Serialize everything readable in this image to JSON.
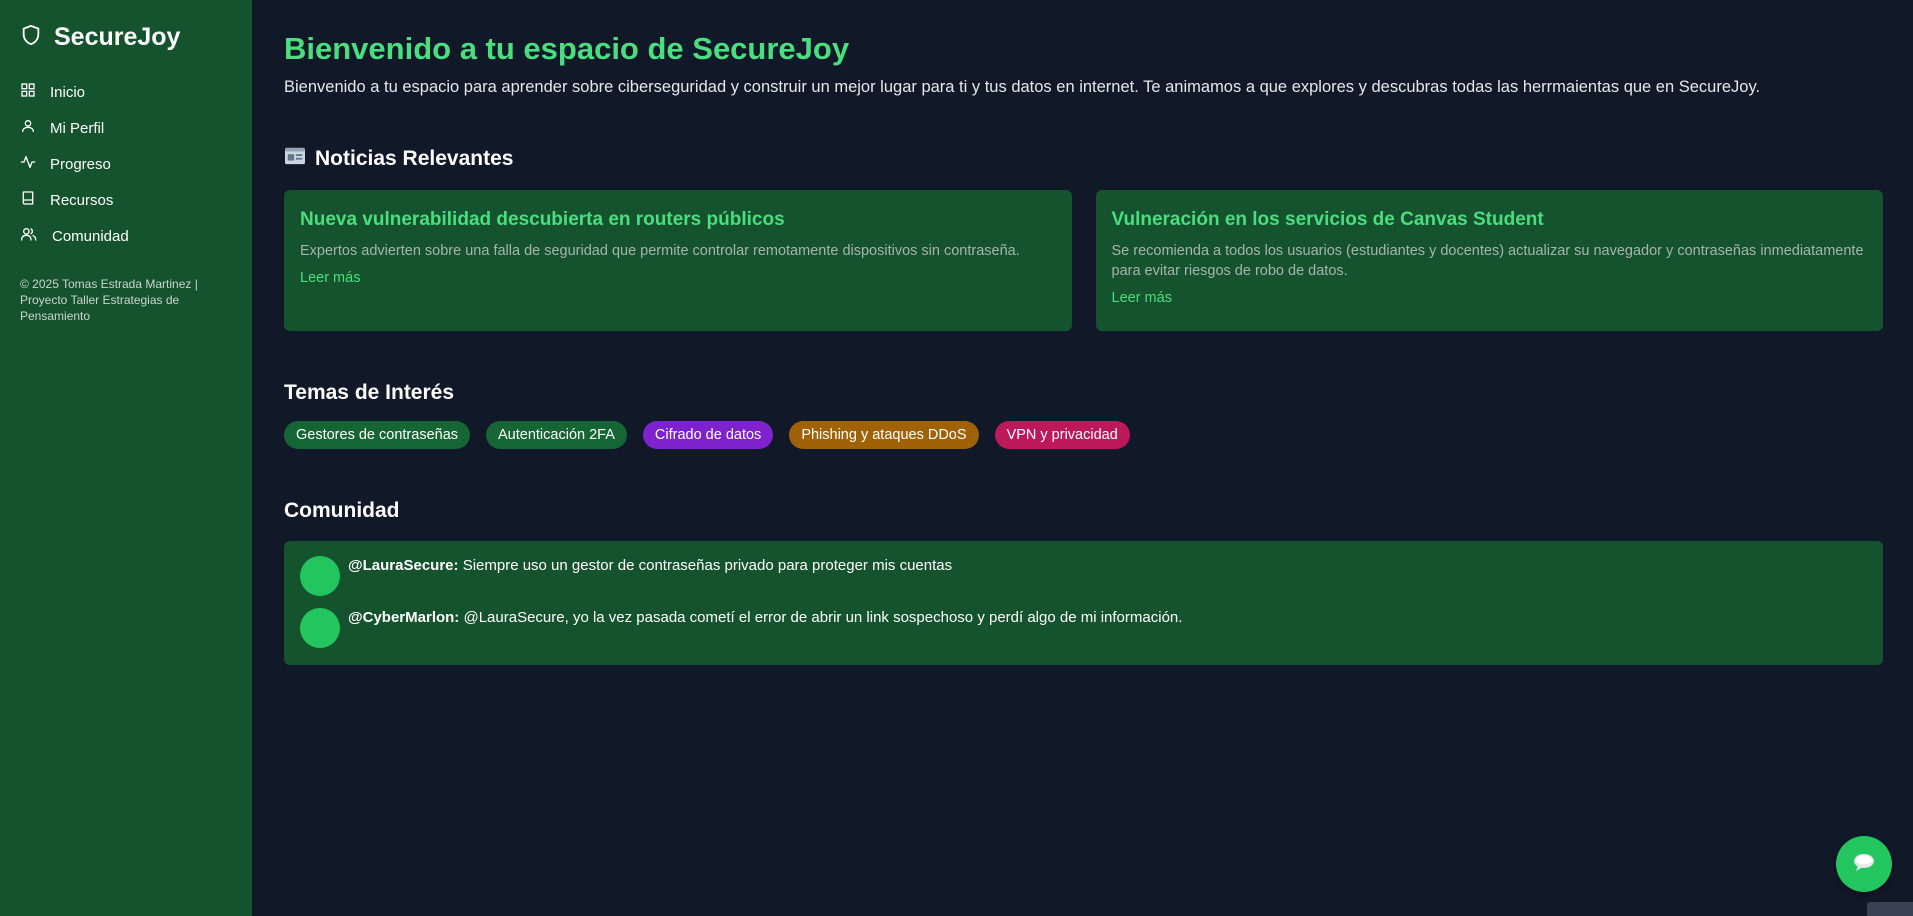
{
  "sidebar": {
    "brand": "SecureJoy",
    "items": [
      {
        "label": "Inicio",
        "icon": "grid-icon"
      },
      {
        "label": "Mi Perfil",
        "icon": "user-icon"
      },
      {
        "label": "Progreso",
        "icon": "activity-icon"
      },
      {
        "label": "Recursos",
        "icon": "book-icon"
      },
      {
        "label": "Comunidad",
        "icon": "users-icon"
      }
    ],
    "copyright": "© 2025 Tomas Estrada Martinez | Proyecto Taller Estrategias de Pensamiento"
  },
  "header": {
    "title": "Bienvenido a tu espacio de SecureJoy",
    "subtitle": "Bienvenido a tu espacio para aprender sobre ciberseguridad y construir un mejor lugar para ti y tus datos en internet. Te animamos a que explores y descubras todas las herrmaientas que en SecureJoy."
  },
  "news": {
    "title": "Noticias Relevantes",
    "icon": "newspaper-icon",
    "cards": [
      {
        "title": "Nueva vulnerabilidad descubierta en routers públicos",
        "description": "Expertos advierten sobre una falla de seguridad que permite controlar remotamente dispositivos sin contraseña.",
        "link": "Leer más"
      },
      {
        "title": "Vulneración en los servicios de Canvas Student",
        "description": "Se recomienda a todos los usuarios (estudiantes y docentes) actualizar su navegador y contraseñas inmediatamente para evitar riesgos de robo de datos.",
        "link": "Leer más"
      }
    ]
  },
  "topics": {
    "title": "Temas de Interés",
    "tags": [
      {
        "label": "Gestores de contraseñas",
        "color": "#166534"
      },
      {
        "label": "Autenticación 2FA",
        "color": "#166534"
      },
      {
        "label": "Cifrado de datos",
        "color": "#7e22ce"
      },
      {
        "label": "Phishing y ataques DDoS",
        "color": "#a16207"
      },
      {
        "label": "VPN y privacidad",
        "color": "#be185d"
      }
    ]
  },
  "community": {
    "title": "Comunidad",
    "comments": [
      {
        "user": "@LauraSecure:",
        "text": "Siempre uso un gestor de contraseñas privado para proteger mis cuentas"
      },
      {
        "user": "@CyberMarlon:",
        "text": "@LauraSecure, yo la vez pasada cometí el error de abrir un link sospechoso y perdí algo de mi información."
      }
    ]
  },
  "chat": {
    "icon": "chat-bubble-icon"
  },
  "colors": {
    "accent": "#4ade80",
    "sidebar_bg": "#14532d",
    "page_bg": "#111827",
    "avatar": "#22c55e"
  }
}
